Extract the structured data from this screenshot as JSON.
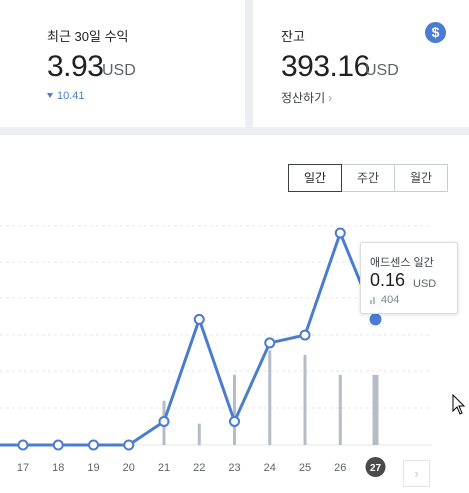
{
  "earnings": {
    "title": "최근 30일 수익",
    "amount": "3.93",
    "unit": "USD",
    "delta": "10.41"
  },
  "balance": {
    "title": "잔고",
    "amount": "393.16",
    "unit": "USD",
    "payout_link": "정산하기",
    "icon": "dollar-icon"
  },
  "period_tabs": [
    "일간",
    "주간",
    "월간"
  ],
  "active_period": "일간",
  "tooltip": {
    "title": "애드센스 일간",
    "value": "0.16",
    "unit": "USD",
    "secondary": "404"
  },
  "colors": {
    "line": "#4a7ccf",
    "bars": "#b4bcc5",
    "accent": "#4a7ccf"
  },
  "chart_data": {
    "type": "line",
    "categories": [
      "17",
      "18",
      "19",
      "20",
      "21",
      "22",
      "23",
      "24",
      "25",
      "26",
      "27"
    ],
    "series": [
      {
        "values": [
          0.0,
          0.0,
          0.0,
          0.0,
          0.03,
          0.16,
          0.03,
          0.13,
          0.14,
          0.27,
          0.16
        ]
      },
      {
        "values": [
          0,
          0,
          0,
          0,
          290,
          140,
          460,
          620,
          590,
          460,
          460
        ]
      }
    ],
    "selected_category": "27",
    "grid": true
  }
}
